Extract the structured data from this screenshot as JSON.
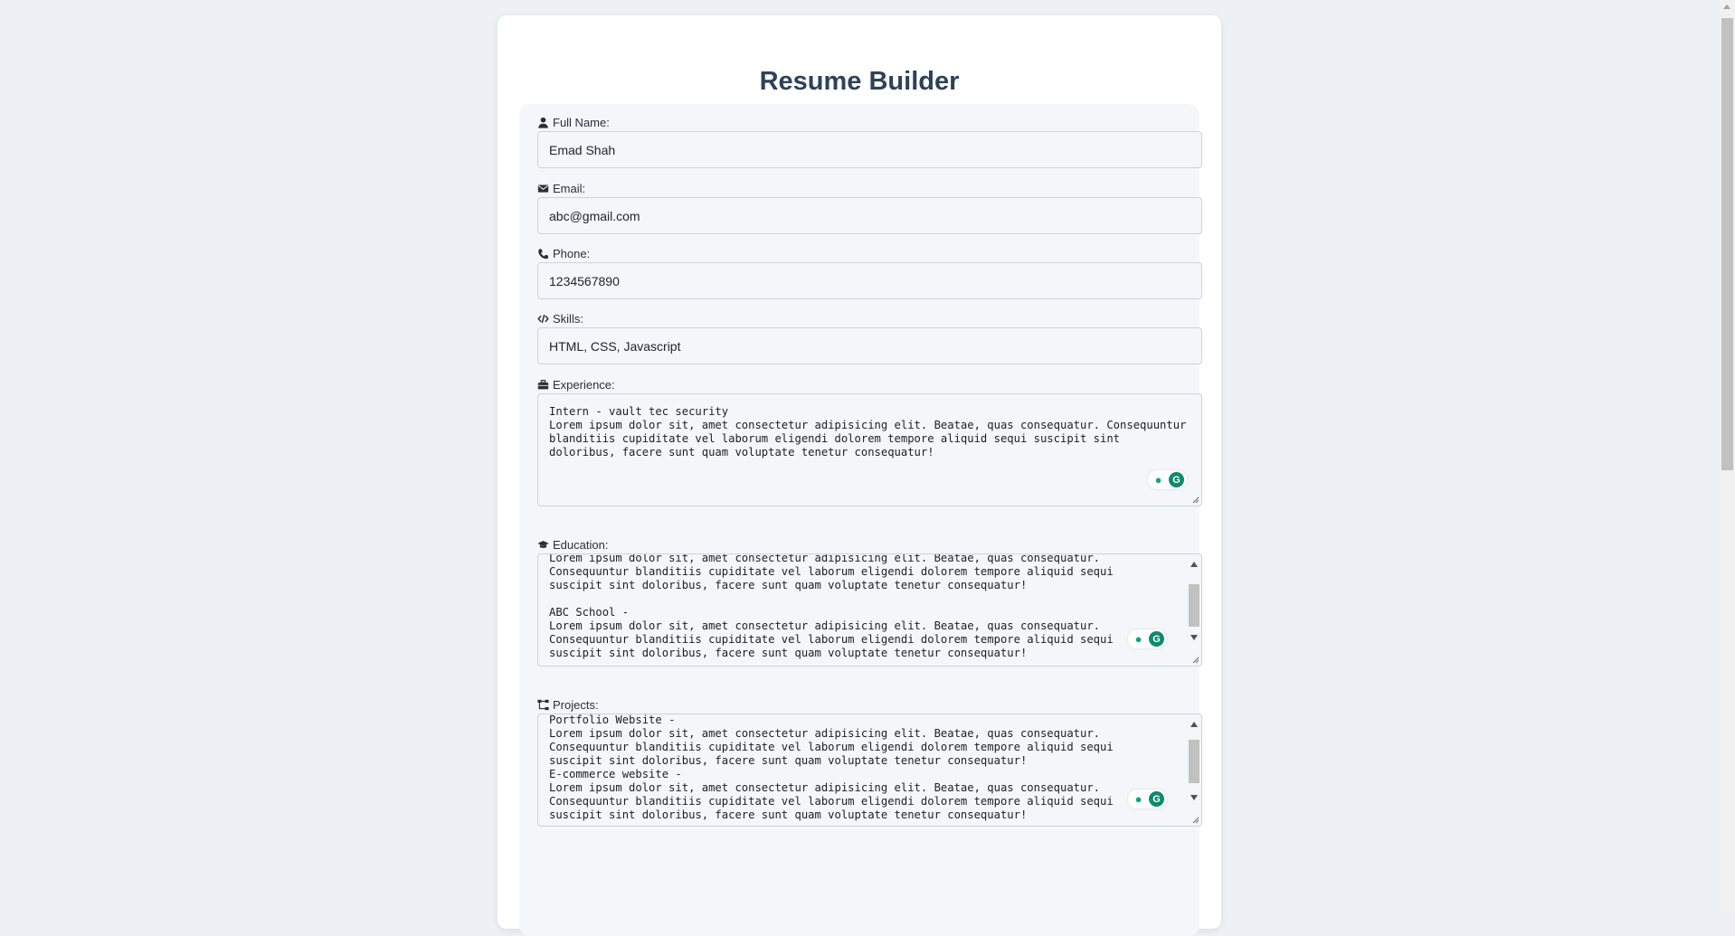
{
  "page": {
    "title": "Resume Builder"
  },
  "fields": {
    "full_name": {
      "label": "Full Name:",
      "value": "Emad Shah",
      "icon": "user-icon"
    },
    "email": {
      "label": "Email:",
      "value": "abc@gmail.com",
      "icon": "envelope-icon"
    },
    "phone": {
      "label": "Phone:",
      "value": "1234567890",
      "icon": "phone-icon"
    },
    "skills": {
      "label": "Skills:",
      "value": "HTML, CSS, Javascript",
      "icon": "code-icon"
    },
    "experience": {
      "label": "Experience:",
      "icon": "briefcase-icon",
      "value": "Intern - vault tec security\nLorem ipsum dolor sit, amet consectetur adipisicing elit. Beatae, quas consequatur. Consequuntur\nblanditiis cupiditate vel laborum eligendi dolorem tempore aliquid sequi suscipit sint\ndoloribus, facere sunt quam voluptate tenetur consequatur!"
    },
    "education": {
      "label": "Education:",
      "icon": "graduation-cap-icon",
      "value": "Lorem ipsum dolor sit, amet consectetur adipisicing elit. Beatae, quas consequatur.\nConsequuntur blanditiis cupiditate vel laborum eligendi dolorem tempore aliquid sequi\nsuscipit sint doloribus, facere sunt quam voluptate tenetur consequatur!\n\nABC School -\nLorem ipsum dolor sit, amet consectetur adipisicing elit. Beatae, quas consequatur.\nConsequuntur blanditiis cupiditate vel laborum eligendi dolorem tempore aliquid sequi\nsuscipit sint doloribus, facere sunt quam voluptate tenetur consequatur!"
    },
    "projects": {
      "label": "Projects:",
      "icon": "sitemap-icon",
      "value": "Portfolio Website -\nLorem ipsum dolor sit, amet consectetur adipisicing elit. Beatae, quas consequatur.\nConsequuntur blanditiis cupiditate vel laborum eligendi dolorem tempore aliquid sequi\nsuscipit sint doloribus, facere sunt quam voluptate tenetur consequatur!\nE-commerce website -\nLorem ipsum dolor sit, amet consectetur adipisicing elit. Beatae, quas consequatur.\nConsequuntur blanditiis cupiditate vel laborum eligendi dolorem tempore aliquid sequi\nsuscipit sint doloribus, facere sunt quam voluptate tenetur consequatur!"
    }
  },
  "extension": {
    "icons": [
      "grammarly-bulb-icon",
      "grammarly-g-icon"
    ],
    "g_glyph": "G"
  },
  "colors": {
    "title": "#2e4257",
    "background": "#edf0f4",
    "grammarly": "#0f8a6c"
  }
}
